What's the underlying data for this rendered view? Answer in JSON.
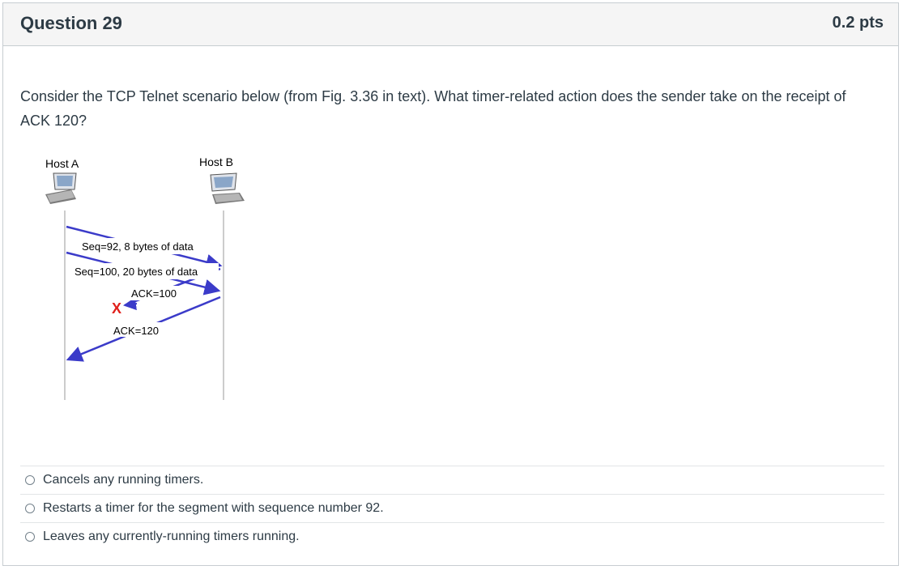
{
  "question": {
    "title": "Question 29",
    "points": "0.2 pts",
    "prompt": "Consider the TCP Telnet scenario below (from Fig. 3.36 in text). What timer-related action does the sender take on the receipt of ACK 120?"
  },
  "diagram": {
    "host_a": "Host A",
    "host_b": "Host B",
    "seg1": "Seq=92, 8 bytes of data",
    "seg2": "Seq=100, 20 bytes of data",
    "ack1": "ACK=100",
    "ack2": "ACK=120",
    "loss_mark": "X",
    "arrow_color": "#3b3bc9",
    "loss_color": "#e0201b"
  },
  "answers": [
    {
      "label": "Cancels any running timers."
    },
    {
      "label": "Restarts a timer for the segment with sequence number 92."
    },
    {
      "label": "Leaves any currently-running timers running."
    }
  ]
}
